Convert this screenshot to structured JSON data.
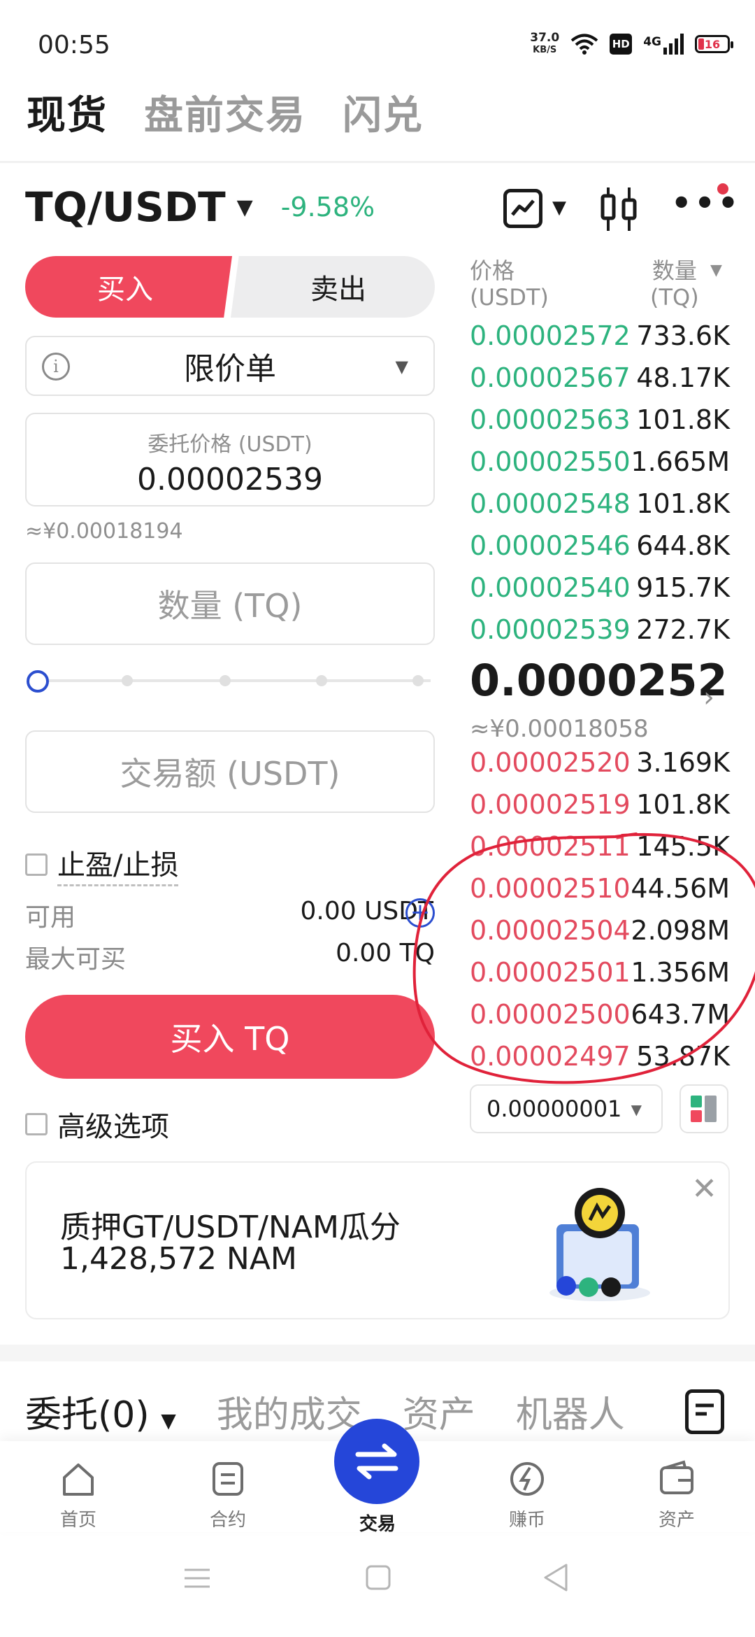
{
  "status_bar": {
    "time": "00:55",
    "net_speed": "37.0",
    "net_unit": "KB/S",
    "hd": "HD",
    "network": "4G",
    "battery": "16"
  },
  "top_tabs": [
    "现货",
    "盘前交易",
    "闪兑"
  ],
  "pair": {
    "name": "TQ/USDT",
    "change": "-9.58%"
  },
  "order_form": {
    "buy_label": "买入",
    "sell_label": "卖出",
    "order_type": "限价单",
    "price_label": "委托价格 (USDT)",
    "price_value": "0.00002539",
    "price_cny": "≈¥0.00018194",
    "qty_placeholder": "数量 (TQ)",
    "amount_placeholder": "交易额 (USDT)",
    "slider_percent": 0,
    "tpsl_label": "止盈/止损",
    "available_label": "可用",
    "available_value": "0.00 USDT",
    "max_buy_label": "最大可买",
    "max_buy_value": "0.00 TQ",
    "buy_button": "买入 TQ",
    "advanced_label": "高级选项"
  },
  "order_book": {
    "price_header": "价格",
    "price_unit": "(USDT)",
    "qty_header": "数量",
    "qty_unit": "(TQ)",
    "asks": [
      {
        "price": "0.00002572",
        "qty": "733.6K"
      },
      {
        "price": "0.00002567",
        "qty": "48.17K"
      },
      {
        "price": "0.00002563",
        "qty": "101.8K"
      },
      {
        "price": "0.00002550",
        "qty": "1.665M"
      },
      {
        "price": "0.00002548",
        "qty": "101.8K"
      },
      {
        "price": "0.00002546",
        "qty": "644.8K"
      },
      {
        "price": "0.00002540",
        "qty": "915.7K"
      },
      {
        "price": "0.00002539",
        "qty": "272.7K"
      }
    ],
    "last_price": "0.0000252",
    "last_price_cny": "≈¥0.00018058",
    "bids": [
      {
        "price": "0.00002520",
        "qty": "3.169K",
        "depth": 0.02
      },
      {
        "price": "0.00002519",
        "qty": "101.8K",
        "depth": 0.02
      },
      {
        "price": "0.00002511",
        "qty": "145.5K",
        "depth": 0.03
      },
      {
        "price": "0.00002510",
        "qty": "44.56M",
        "depth": 0.1
      },
      {
        "price": "0.00002504",
        "qty": "2.098M",
        "depth": 0.1
      },
      {
        "price": "0.00002501",
        "qty": "1.356M",
        "depth": 0.1
      },
      {
        "price": "0.00002500",
        "qty": "643.7M",
        "depth": 0.85
      },
      {
        "price": "0.00002497",
        "qty": "53.87K",
        "depth": 0.1
      }
    ],
    "precision": "0.00000001"
  },
  "promo": {
    "line1": "质押GT/USDT/NAM瓜分",
    "line2": "1,428,572 NAM"
  },
  "bottom_tabs": [
    "委托(0)",
    "我的成交",
    "资产",
    "机器人"
  ],
  "nav": {
    "home": "首页",
    "futures": "合约",
    "trade": "交易",
    "earn": "赚币",
    "assets": "资产"
  },
  "colors": {
    "buy": "#f0485d",
    "ask_green": "#2db37e",
    "bid_red": "#e34a5e",
    "accent_blue": "#2546d9"
  }
}
